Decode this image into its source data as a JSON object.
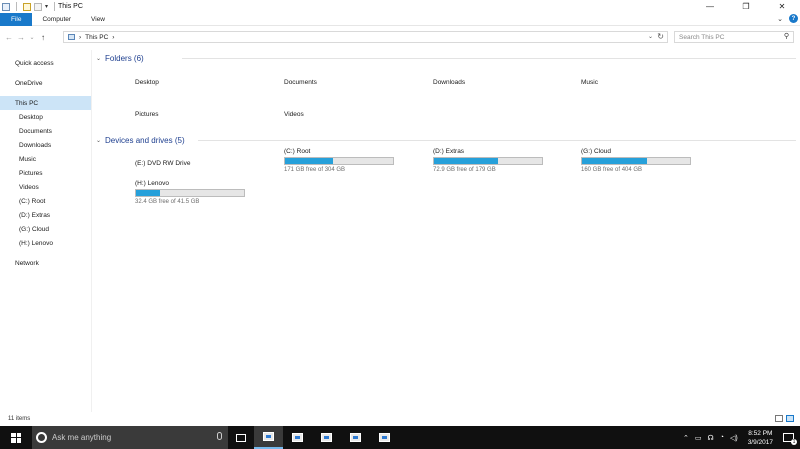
{
  "window": {
    "title": "This PC"
  },
  "ribbon": {
    "tabs": [
      "File",
      "Computer",
      "View"
    ]
  },
  "address": {
    "path": [
      "This PC"
    ],
    "separator": "›",
    "search_placeholder": "Search This PC"
  },
  "nav": {
    "quick_access": "Quick access",
    "onedrive": "OneDrive",
    "this_pc": "This PC",
    "this_pc_children": [
      "Desktop",
      "Documents",
      "Downloads",
      "Music",
      "Pictures",
      "Videos",
      "(C:) Root",
      "(D:) Extras",
      "(G:) Cloud",
      "(H:) Lenovo"
    ],
    "network": "Network"
  },
  "groups": {
    "folders_header": "Folders (6)",
    "folders": [
      "Desktop",
      "Documents",
      "Downloads",
      "Music",
      "Pictures",
      "Videos"
    ],
    "devices_header": "Devices and drives (5)",
    "dvd": {
      "name": "(E:) DVD RW Drive"
    },
    "drives": [
      {
        "name": "(C:) Root",
        "free": "171 GB free of 304 GB",
        "used_fraction": 0.44
      },
      {
        "name": "(D:) Extras",
        "free": "72.9 GB free of 179 GB",
        "used_fraction": 0.59
      },
      {
        "name": "(G:) Cloud",
        "free": "160 GB free of 404 GB",
        "used_fraction": 0.6
      },
      {
        "name": "(H:) Lenovo",
        "free": "32.4 GB free of 41.5 GB",
        "used_fraction": 0.22
      }
    ]
  },
  "status": {
    "items": "11 items"
  },
  "taskbar": {
    "search_placeholder": "Ask me anything",
    "time": "8:52 PM",
    "date": "3/9/2017"
  },
  "colors": {
    "accent": "#1979ca",
    "selection": "#cce4f7",
    "drive_fill": "#26a0da",
    "group_header": "#1e3f8f",
    "taskbar": "#101010"
  }
}
